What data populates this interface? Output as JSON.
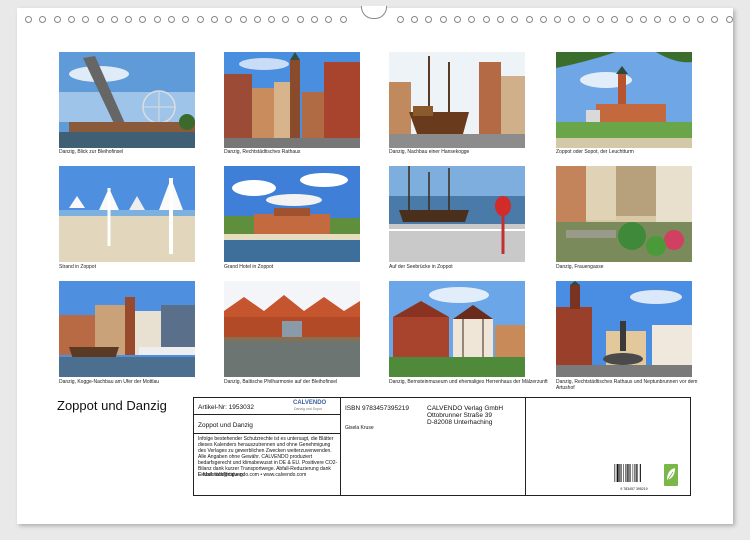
{
  "title": "Zoppot und Danzig",
  "photos": [
    {
      "caption": "Danzig, Blick zur Bleihofinsel",
      "icon": "gdansk-ferris-wheel-photo"
    },
    {
      "caption": "Danzig, Rechtstädtisches Rathaus",
      "icon": "gdansk-town-hall-photo"
    },
    {
      "caption": "Danzig, Nachbau einer Hansekogge",
      "icon": "hanseatic-cog-replica-photo"
    },
    {
      "caption": "Zoppot oder Sopot, der Leuchtturm",
      "icon": "sopot-lighthouse-photo"
    },
    {
      "caption": "Strand in Zoppot",
      "icon": "sopot-beach-photo"
    },
    {
      "caption": "Grand Hotel in Zoppot",
      "icon": "grand-hotel-photo"
    },
    {
      "caption": "Auf der Seebrücke in Zoppot",
      "icon": "sopot-pier-photo"
    },
    {
      "caption": "Danzig, Frauengasse",
      "icon": "mariacka-street-photo"
    },
    {
      "caption": "Danzig, Kogge-Nachbau am Ufer der Mottlau",
      "icon": "motlawa-riverside-photo"
    },
    {
      "caption": "Danzig, Baltische Philharmonie auf der Bleihofinsel",
      "icon": "baltic-philharmonic-photo"
    },
    {
      "caption": "Danzig, Bernsteinmuseum und ehemaliges Herrenhaus der Mälzerzunft",
      "icon": "amber-museum-photo"
    },
    {
      "caption": "Danzig, Rechtstädtisches Rathaus und Neptunbrunnen vor dem Artushof",
      "icon": "neptune-fountain-photo"
    }
  ],
  "info": {
    "article": "Artikel-Nr: 1953032",
    "logo_text": "CALVENDO",
    "logo_sub": "Danzig und Sopot",
    "calendar_title": "Zoppot und Danzig",
    "disclaimer": "Infolge bestehender Schutzrechte ist es untersagt, die Blätter dieses Kalenders herauszutrennen und ohne Genehmigung des Verlages zu gewerblichen Zwecken weiterzuverwenden. Alle Angaben ohne Gewähr. CALVENDO produziert bedarfsgerecht und klimabewusst in DE & EU. Positivere CO2-Bilanz dank kurzer Transportwege. Abfall-Reduzierung dank Einzelstückfertigung.",
    "contact": "E-Mail: info@calvendo.com • www.calvendo.com",
    "isbn": "ISBN 9783457395219",
    "author": "Gisela Kruse",
    "publisher": "CALVENDO Verlag GmbH",
    "street": "Ottobrunner Straße 39",
    "city": "D-82008 Unterhaching",
    "barcode_number": "9 783457 395219",
    "eco_icon": "recycling-leaf-icon"
  }
}
